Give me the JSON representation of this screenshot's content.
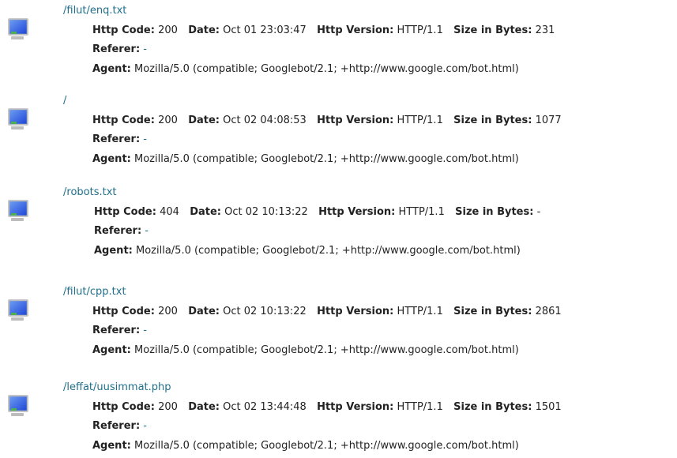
{
  "labels": {
    "http_code": "Http Code:",
    "date": "Date:",
    "http_version": "Http Version:",
    "size": "Size in Bytes:",
    "referer": "Referer:",
    "agent": "Agent:"
  },
  "entries": [
    {
      "path": "/filut/enq.txt",
      "http_code": "200",
      "date": "Oct 01 23:03:47",
      "http_version": "HTTP/1.1",
      "size": "231",
      "referer": "-",
      "agent": "Mozilla/5.0 (compatible; Googlebot/2.1; +http://www.google.com/bot.html)",
      "icon": "monitor-icon"
    },
    {
      "path": "/",
      "http_code": "200",
      "date": "Oct 02 04:08:53",
      "http_version": "HTTP/1.1",
      "size": "1077",
      "referer": "-",
      "agent": "Mozilla/5.0 (compatible; Googlebot/2.1; +http://www.google.com/bot.html)",
      "icon": "monitor-icon"
    },
    {
      "path": "/robots.txt",
      "http_code": "404",
      "date": "Oct 02 10:13:22",
      "http_version": "HTTP/1.1",
      "size": "-",
      "referer": "-",
      "agent": "Mozilla/5.0 (compatible; Googlebot/2.1; +http://www.google.com/bot.html)",
      "icon": "monitor-icon"
    },
    {
      "path": "/filut/cpp.txt",
      "http_code": "200",
      "date": "Oct 02 10:13:22",
      "http_version": "HTTP/1.1",
      "size": "2861",
      "referer": "-",
      "agent": "Mozilla/5.0 (compatible; Googlebot/2.1; +http://www.google.com/bot.html)",
      "icon": "monitor-icon"
    },
    {
      "path": "/leffat/uusimmat.php",
      "http_code": "200",
      "date": "Oct 02 13:44:48",
      "http_version": "HTTP/1.1",
      "size": "1501",
      "referer": "-",
      "agent": "Mozilla/5.0 (compatible; Googlebot/2.1; +http://www.google.com/bot.html)",
      "icon": "monitor-icon"
    }
  ],
  "colors": {
    "link": "#1f6f8b",
    "text": "#222222",
    "monitor_screen_top": "#1e46d8",
    "monitor_screen_bottom": "#6f9df2",
    "monitor_frame": "#c8c8c8",
    "monitor_status": "#4caf50"
  }
}
